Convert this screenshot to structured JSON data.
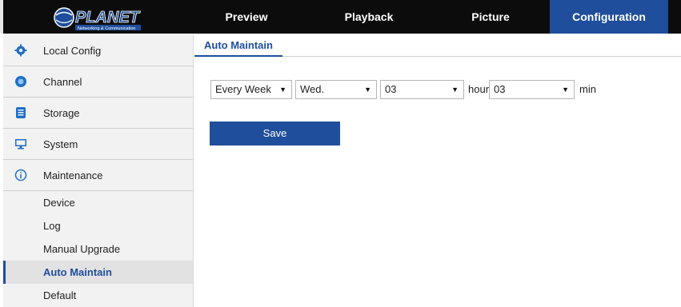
{
  "header": {
    "logo_text": "PLANET",
    "logo_subtext": "Networking & Communication",
    "tabs": [
      {
        "label": "Preview"
      },
      {
        "label": "Playback"
      },
      {
        "label": "Picture"
      },
      {
        "label": "Configuration",
        "active": true
      }
    ],
    "active_color": "#1f4e9c"
  },
  "sidebar": {
    "items": [
      {
        "label": "Local Config",
        "icon": "gear-icon"
      },
      {
        "label": "Channel",
        "icon": "camera-lens-icon"
      },
      {
        "label": "Storage",
        "icon": "storage-icon"
      },
      {
        "label": "System",
        "icon": "monitor-icon"
      },
      {
        "label": "Maintenance",
        "icon": "info-icon"
      }
    ],
    "sub_items": [
      {
        "label": "Device"
      },
      {
        "label": "Log"
      },
      {
        "label": "Manual Upgrade"
      },
      {
        "label": "Auto Maintain",
        "active": true
      },
      {
        "label": "Default"
      }
    ]
  },
  "main": {
    "title": "Auto Maintain",
    "schedule": {
      "frequency": "Every Week",
      "day": "Wed.",
      "hour": "03",
      "hour_unit": "hour",
      "minute": "03",
      "minute_unit": "min"
    },
    "save_label": "Save"
  }
}
